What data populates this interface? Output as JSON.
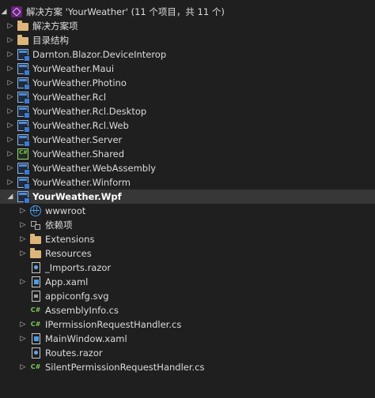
{
  "solution": {
    "label": "解决方案 'YourWeather' (11 个项目，共 11 个)"
  },
  "items": [
    {
      "label": "解决方案项",
      "icon": "folder-icon"
    },
    {
      "label": "目录结构",
      "icon": "folder-icon"
    },
    {
      "label": "Darnton.Blazor.DeviceInterop",
      "icon": "project-icon"
    },
    {
      "label": "YourWeather.Maui",
      "icon": "project-icon"
    },
    {
      "label": "YourWeather.Photino",
      "icon": "project-icon"
    },
    {
      "label": "YourWeather.Rcl",
      "icon": "project-icon"
    },
    {
      "label": "YourWeather.Rcl.Desktop",
      "icon": "project-icon"
    },
    {
      "label": "YourWeather.Rcl.Web",
      "icon": "project-icon"
    },
    {
      "label": "YourWeather.Server",
      "icon": "project-icon"
    },
    {
      "label": "YourWeather.Shared",
      "icon": "shared-project-icon"
    },
    {
      "label": "YourWeather.WebAssembly",
      "icon": "project-icon"
    },
    {
      "label": "YourWeather.Winform",
      "icon": "project-icon"
    },
    {
      "label": "YourWeather.Wpf",
      "icon": "project-icon"
    }
  ],
  "wpf_children": [
    {
      "label": "wwwroot",
      "icon": "globe-icon"
    },
    {
      "label": "依赖项",
      "icon": "dependencies-icon"
    },
    {
      "label": "Extensions",
      "icon": "folder-icon"
    },
    {
      "label": "Resources",
      "icon": "folder-icon"
    },
    {
      "label": "_Imports.razor",
      "icon": "razor-file-icon"
    },
    {
      "label": "App.xaml",
      "icon": "xaml-file-icon"
    },
    {
      "label": "appiconfg.svg",
      "icon": "svg-file-icon"
    },
    {
      "label": "AssemblyInfo.cs",
      "icon": "csharp-file-icon"
    },
    {
      "label": "IPermissionRequestHandler.cs",
      "icon": "csharp-file-icon"
    },
    {
      "label": "MainWindow.xaml",
      "icon": "xaml-file-icon"
    },
    {
      "label": "Routes.razor",
      "icon": "razor-file-icon"
    },
    {
      "label": "SilentPermissionRequestHandler.cs",
      "icon": "csharp-file-icon"
    }
  ],
  "colors": {
    "background": "#1f1f1f",
    "selected_row": "#373737",
    "text": "#dcdcdc"
  }
}
